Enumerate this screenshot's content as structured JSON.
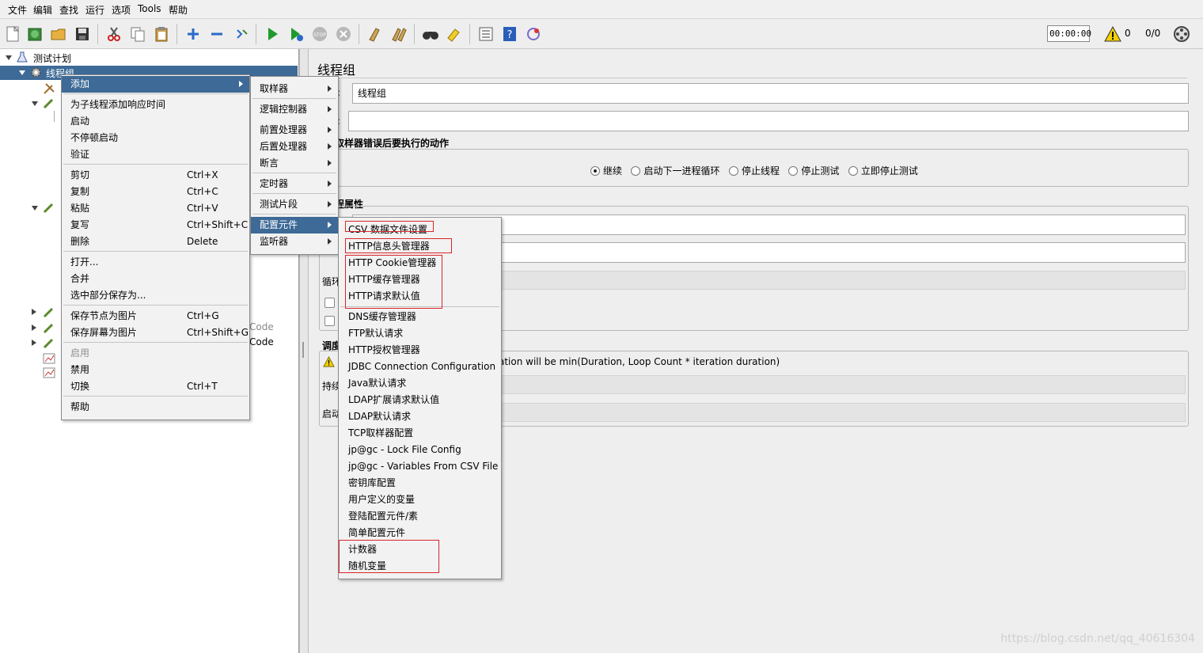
{
  "menubar": [
    "文件",
    "编辑",
    "查找",
    "运行",
    "选项",
    "Tools",
    "帮助"
  ],
  "toolbar": {
    "timer": "00:00:00",
    "warning_count": "0",
    "thread_ratio": "0/0"
  },
  "tree": {
    "plan": "测试计划",
    "thread_group": "线程组",
    "code1": "Code",
    "code2": "Code"
  },
  "panel": {
    "title": "线程组",
    "name_suffix": ":",
    "name_value": "线程组",
    "comment_suffix": ":",
    "on_error_title": "取样器错误后要执行的动作",
    "on_error_options": [
      "继续",
      "启动下一进程循环",
      "停止线程",
      "停止测试",
      "立即停止测试"
    ],
    "props_title": "程属性",
    "loop_partial": "循环",
    "scheduler_partial": "调度",
    "warning_text": "ation will be min(Duration, Loop Count * iteration duration)",
    "duration_partial": "持续",
    "startup_partial": "启动"
  },
  "context_menu": {
    "items": [
      {
        "label": "添加",
        "shortcut": "",
        "submenu": true,
        "selected": true
      },
      {
        "label": "为子线程添加响应时间",
        "shortcut": ""
      },
      {
        "label": "启动",
        "shortcut": ""
      },
      {
        "label": "不停顿启动",
        "shortcut": ""
      },
      {
        "label": "验证",
        "shortcut": ""
      },
      {
        "label": "剪切",
        "shortcut": "Ctrl+X"
      },
      {
        "label": "复制",
        "shortcut": "Ctrl+C"
      },
      {
        "label": "粘贴",
        "shortcut": "Ctrl+V"
      },
      {
        "label": "复写",
        "shortcut": "Ctrl+Shift+C"
      },
      {
        "label": "删除",
        "shortcut": "Delete"
      },
      {
        "label": "打开...",
        "shortcut": ""
      },
      {
        "label": "合并",
        "shortcut": ""
      },
      {
        "label": "选中部分保存为...",
        "shortcut": ""
      },
      {
        "label": "保存节点为图片",
        "shortcut": "Ctrl+G"
      },
      {
        "label": "保存屏幕为图片",
        "shortcut": "Ctrl+Shift+G"
      },
      {
        "label": "启用",
        "shortcut": "",
        "disabled": true
      },
      {
        "label": "禁用",
        "shortcut": ""
      },
      {
        "label": "切换",
        "shortcut": "Ctrl+T"
      },
      {
        "label": "帮助",
        "shortcut": ""
      }
    ]
  },
  "add_menu": {
    "items": [
      {
        "label": "取样器"
      },
      {
        "label": "逻辑控制器"
      },
      {
        "label": "前置处理器"
      },
      {
        "label": "后置处理器"
      },
      {
        "label": "断言"
      },
      {
        "label": "定时器"
      },
      {
        "label": "测试片段"
      },
      {
        "label": "配置元件",
        "selected": true
      },
      {
        "label": "监听器"
      }
    ]
  },
  "config_menu": {
    "items": [
      "CSV 数据文件设置",
      "HTTP信息头管理器",
      "HTTP Cookie管理器",
      "HTTP缓存管理器",
      "HTTP请求默认值",
      "DNS缓存管理器",
      "FTP默认请求",
      "HTTP授权管理器",
      "JDBC Connection Configuration",
      "Java默认请求",
      "LDAP扩展请求默认值",
      "LDAP默认请求",
      "TCP取样器配置",
      "jp@gc - Lock File Config",
      "jp@gc - Variables From CSV File",
      "密钥库配置",
      "用户定义的变量",
      "登陆配置元件/素",
      "简单配置元件",
      "计数器",
      "随机变量"
    ]
  },
  "watermark": "https://blog.csdn.net/qq_40616304",
  "colors": {
    "selection": "#3d6a96",
    "highlight_box": "#d8262b"
  }
}
